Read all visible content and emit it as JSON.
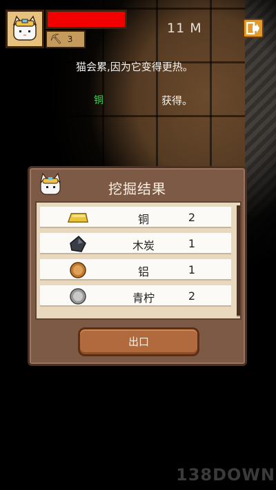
{
  "hud": {
    "hp_fraction": 1.0,
    "level": "3",
    "depth": "11 M"
  },
  "messages": {
    "line1": "猫会累,因为它变得更热。",
    "ore": "铜",
    "obtained": "获得。"
  },
  "dialog": {
    "title": "挖掘结果",
    "items": [
      {
        "icon": "gold-bar-icon",
        "name": "铜",
        "qty": "2"
      },
      {
        "icon": "coal-icon",
        "name": "木炭",
        "qty": "1"
      },
      {
        "icon": "bronze-ore-icon",
        "name": "铝",
        "qty": "1"
      },
      {
        "icon": "silver-ore-icon",
        "name": "青柠",
        "qty": "2"
      }
    ],
    "exit_label": "出口"
  },
  "watermark": "138DOWN",
  "colors": {
    "hp": "#f20000",
    "ore_text": "#3fcf5a",
    "dialog_bg": "#7d5a45",
    "button": "#b06a3d"
  }
}
